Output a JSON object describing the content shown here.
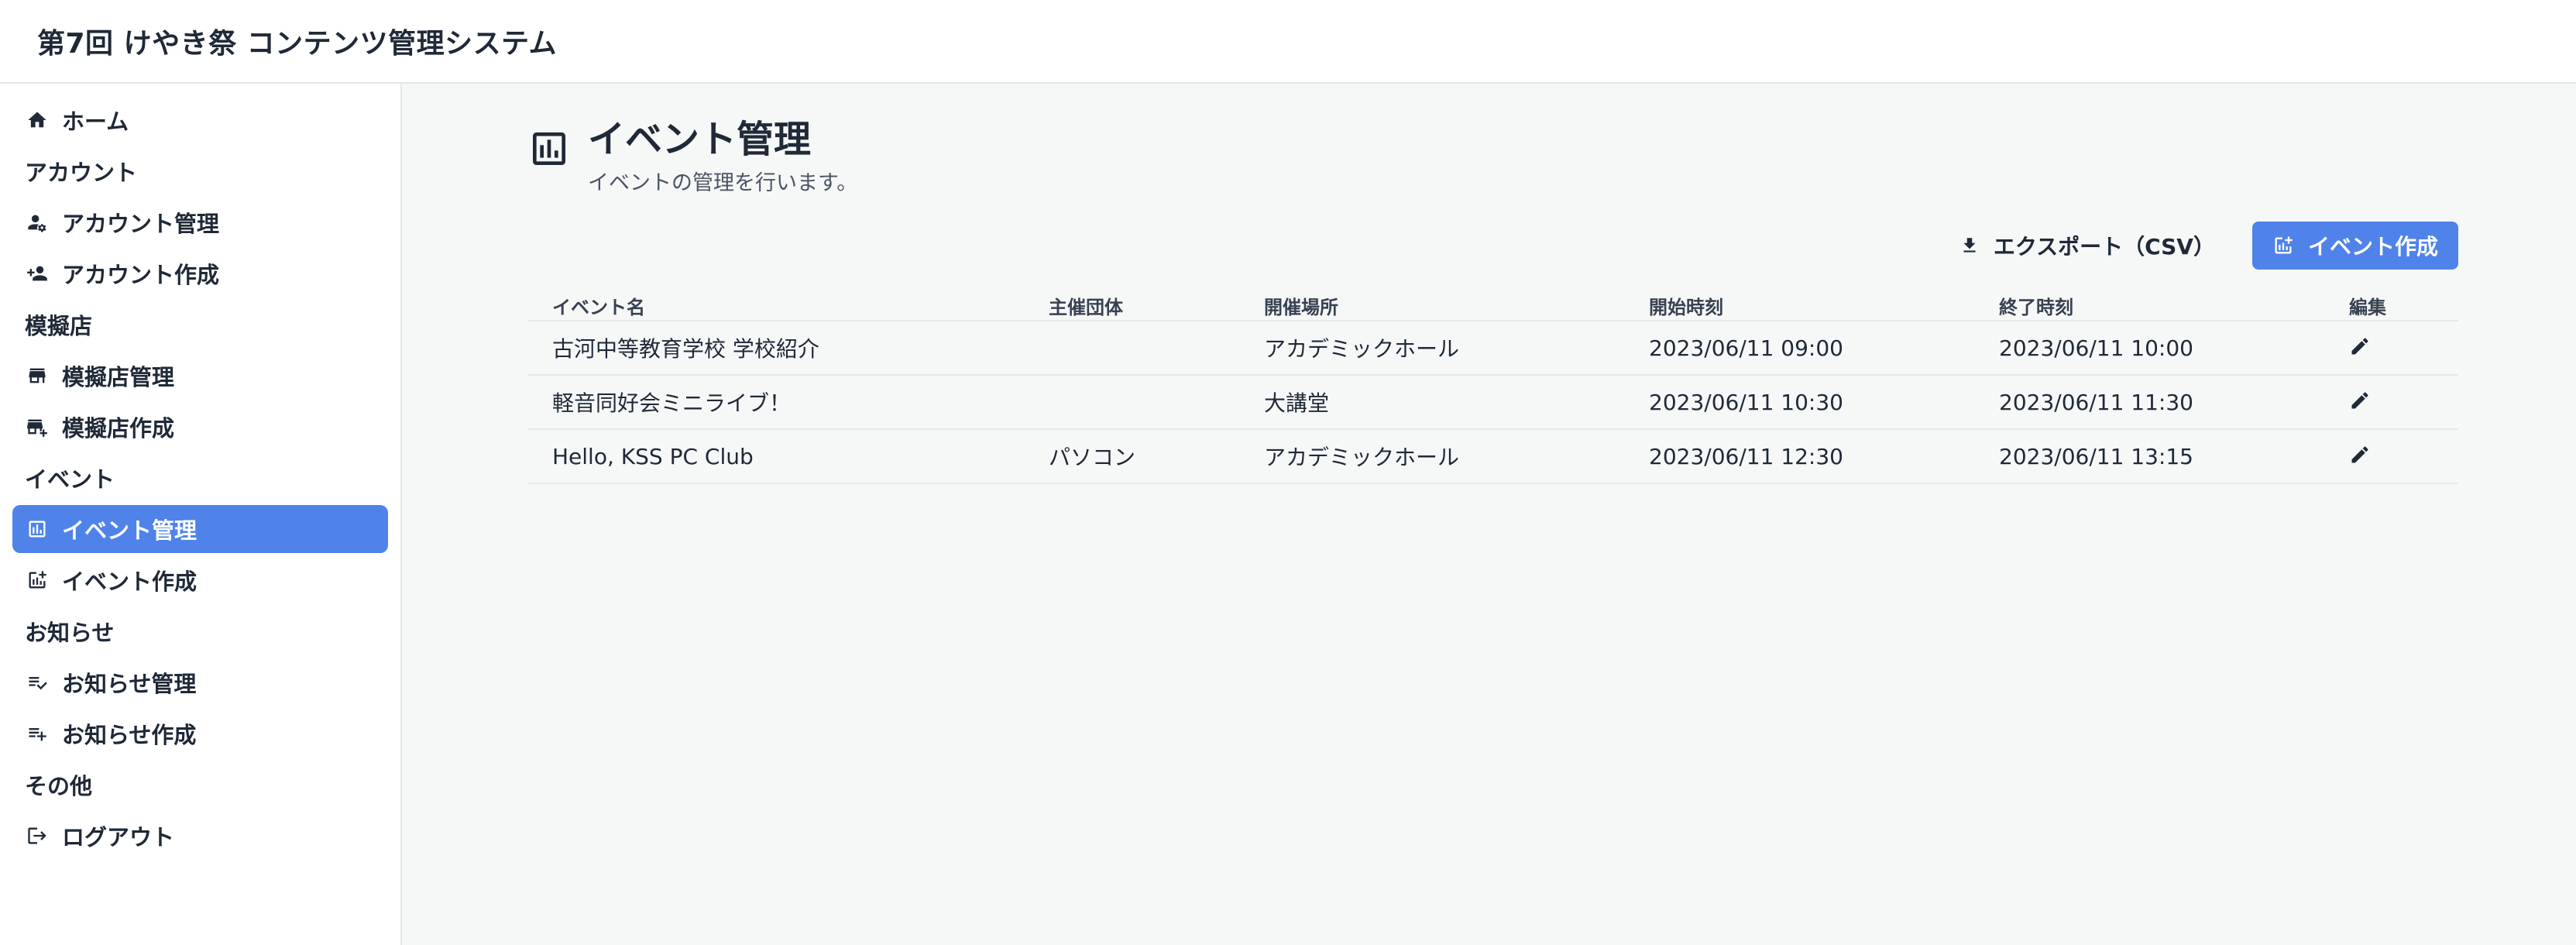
{
  "app": {
    "title": "第7回 けやき祭 コンテンツ管理システム"
  },
  "sidebar": {
    "entries": [
      {
        "kind": "item",
        "icon": "home-icon",
        "label": "ホーム",
        "active": false
      },
      {
        "kind": "section",
        "label": "アカウント"
      },
      {
        "kind": "item",
        "icon": "manage-accounts-icon",
        "label": "アカウント管理",
        "active": false
      },
      {
        "kind": "item",
        "icon": "person-add-icon",
        "label": "アカウント作成",
        "active": false
      },
      {
        "kind": "section",
        "label": "模擬店"
      },
      {
        "kind": "item",
        "icon": "store-icon",
        "label": "模擬店管理",
        "active": false
      },
      {
        "kind": "item",
        "icon": "add-business-icon",
        "label": "模擬店作成",
        "active": false
      },
      {
        "kind": "section",
        "label": "イベント"
      },
      {
        "kind": "item",
        "icon": "analytics-icon",
        "label": "イベント管理",
        "active": true
      },
      {
        "kind": "item",
        "icon": "add-chart-icon",
        "label": "イベント作成",
        "active": false
      },
      {
        "kind": "section",
        "label": "お知らせ"
      },
      {
        "kind": "item",
        "icon": "playlist-check-icon",
        "label": "お知らせ管理",
        "active": false
      },
      {
        "kind": "item",
        "icon": "playlist-add-icon",
        "label": "お知らせ作成",
        "active": false
      },
      {
        "kind": "section",
        "label": "その他"
      },
      {
        "kind": "item",
        "icon": "logout-icon",
        "label": "ログアウト",
        "active": false
      }
    ]
  },
  "page": {
    "icon": "analytics-icon",
    "title": "イベント管理",
    "subtitle": "イベントの管理を行います。"
  },
  "toolbar": {
    "export_label": "エクスポート（CSV）",
    "create_label": "イベント作成"
  },
  "table": {
    "columns": [
      "イベント名",
      "主催団体",
      "開催場所",
      "開始時刻",
      "終了時刻",
      "編集"
    ],
    "rows": [
      [
        "古河中等教育学校 学校紹介",
        "",
        "アカデミックホール",
        "2023/06/11 09:00",
        "2023/06/11 10:00"
      ],
      [
        "軽音同好会ミニライブ！",
        "",
        "大講堂",
        "2023/06/11 10:30",
        "2023/06/11 11:30"
      ],
      [
        "Hello, KSS PC Club",
        "パソコン",
        "アカデミックホール",
        "2023/06/11 12:30",
        "2023/06/11 13:15"
      ]
    ]
  },
  "colors": {
    "accent": "#4f83ea",
    "text": "#1f2937",
    "background": "#f6f8f8"
  }
}
